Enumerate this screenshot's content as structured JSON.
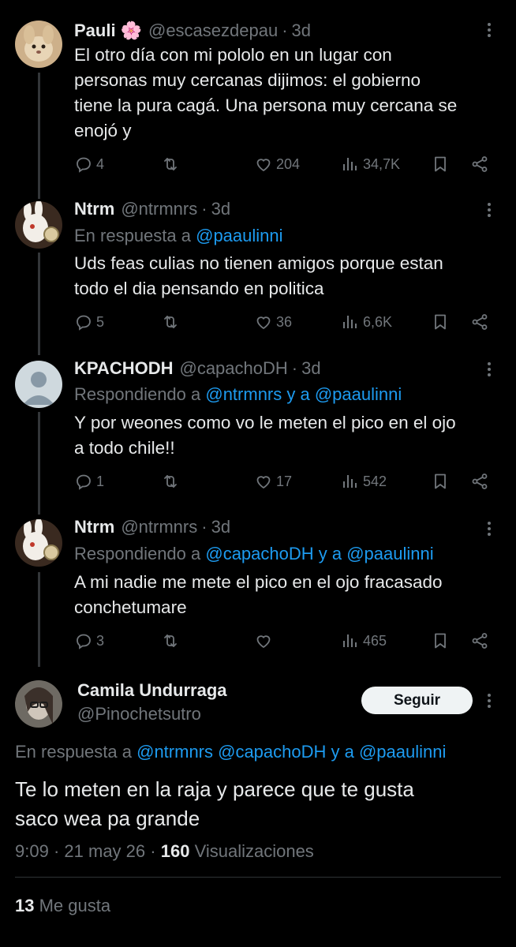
{
  "tweets": [
    {
      "name": "Pauli",
      "name_emoji": "🌸",
      "handle": "@escasezdepau",
      "time": "3d",
      "reply_prefix": "",
      "reply_links": "",
      "text": "El otro día con mi pololo en un lugar con\npersonas muy cercanas dijimos: el gobierno\ntiene la pura cagá. Una persona muy cercana se\nenojó y",
      "replies": "4",
      "retweets": "",
      "likes": "204",
      "views": "34,7K"
    },
    {
      "name": "Ntrm",
      "handle": "@ntrmnrs",
      "time": "3d",
      "reply_prefix": "En respuesta a ",
      "reply_links": "@paaulinni",
      "text": "Uds feas culias no tienen amigos porque estan\ntodo el dia pensando en politica",
      "replies": "5",
      "retweets": "",
      "likes": "36",
      "views": "6,6K"
    },
    {
      "name": "KPACHODH",
      "handle": "@capachoDH",
      "time": "3d",
      "reply_prefix": "Respondiendo a ",
      "reply_links": "@ntrmnrs y a @paaulinni",
      "text": "Y por weones como vo le meten el pico en el ojo\na todo chile!!",
      "replies": "1",
      "retweets": "",
      "likes": "17",
      "views": "542"
    },
    {
      "name": "Ntrm",
      "handle": "@ntrmnrs",
      "time": "3d",
      "reply_prefix": "Respondiendo a ",
      "reply_links": "@capachoDH y a @paaulinni",
      "text": "A mi nadie me mete el pico en el ojo fracasado\nconchetumare",
      "replies": "3",
      "retweets": "",
      "likes": "",
      "views": "465"
    }
  ],
  "main": {
    "name": "Camila Undurraga",
    "handle": "@Pinochetsutro",
    "follow_label": "Seguir",
    "reply_prefix": "En respuesta a ",
    "reply_links": "@ntrmnrs @capachoDH y a @paaulinni",
    "text": "Te lo meten en la raja y parece que te gusta\nsaco wea pa grande",
    "time": "9:09",
    "date": "21 may 26",
    "views_count": "160",
    "views_label": "Visualizaciones",
    "likes_count": "13",
    "likes_label": "Me gusta"
  },
  "colors": {
    "background": "#000000",
    "text": "#e7e9ea",
    "muted": "#71767b",
    "link": "#1d9bf0"
  },
  "icons": [
    "reply-icon",
    "retweet-icon",
    "like-icon",
    "views-icon",
    "bookmark-icon",
    "share-icon",
    "more-icon"
  ]
}
